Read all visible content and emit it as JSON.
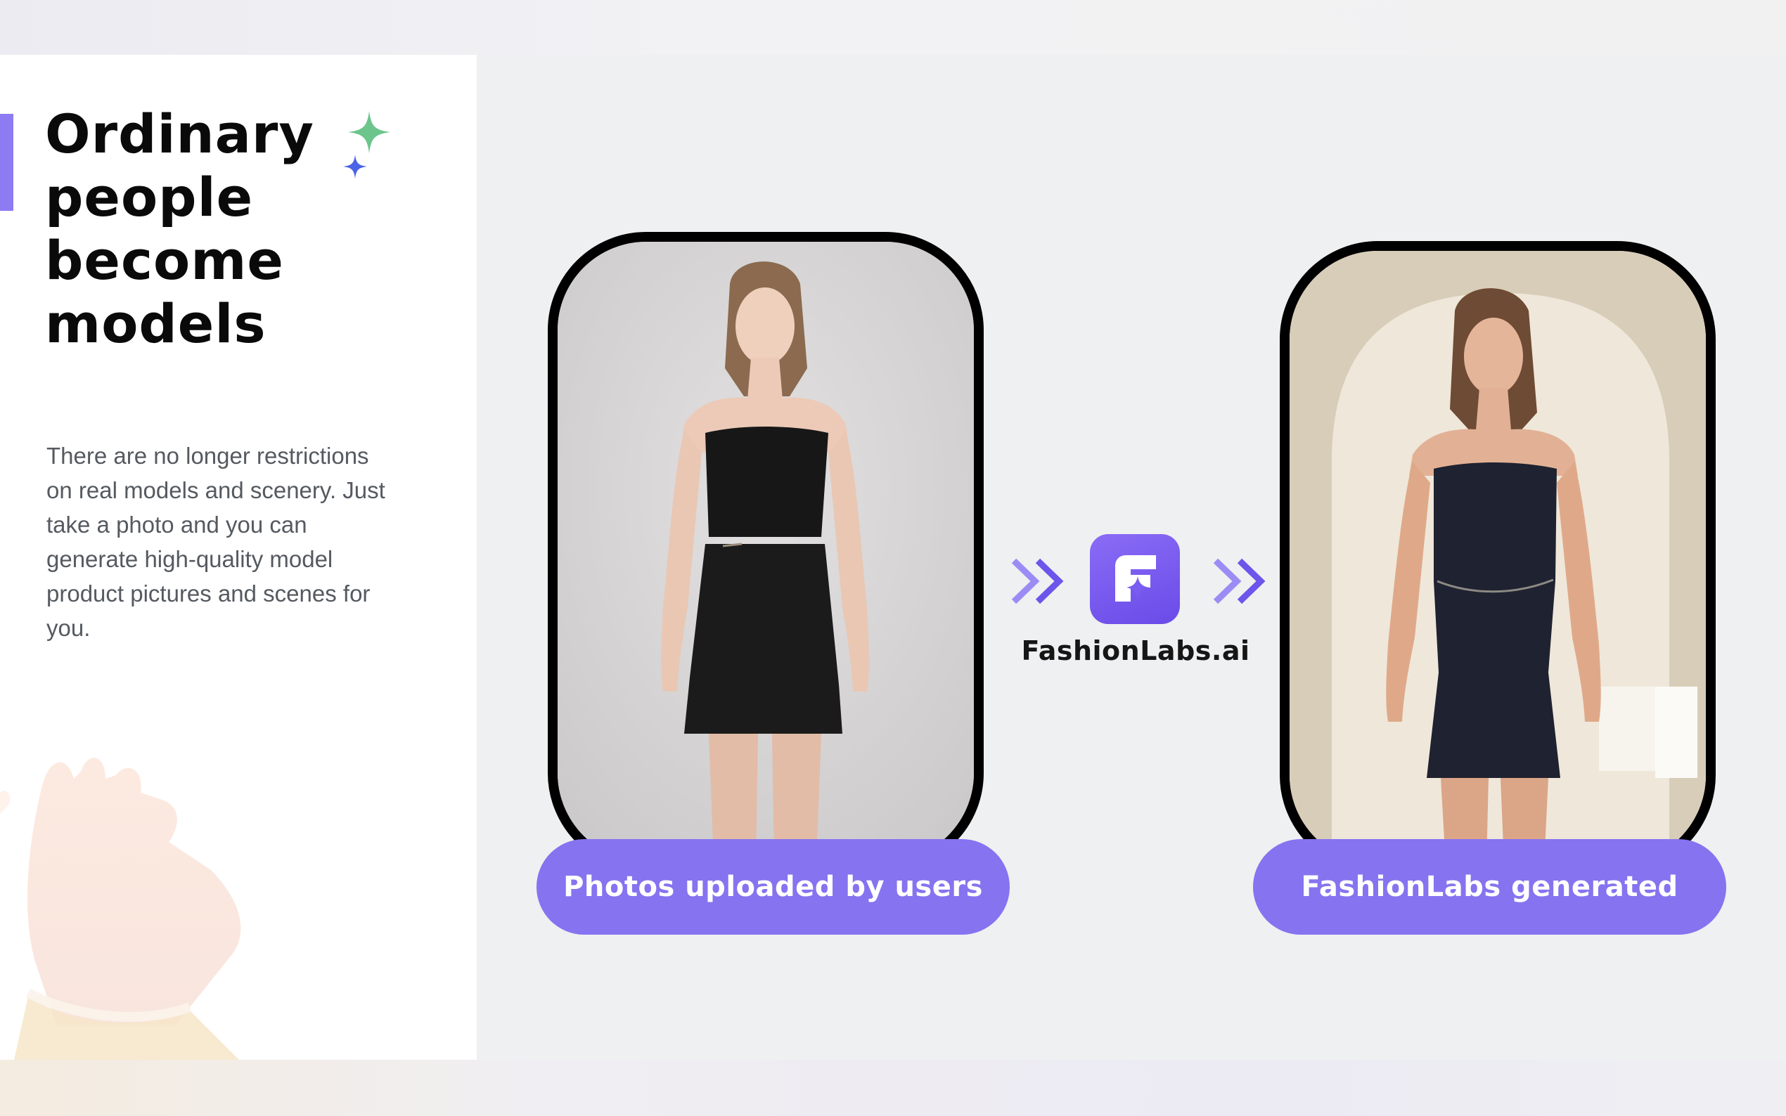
{
  "headline": "Ordinary people become models",
  "description": "There are no longer restrictions on real models and scenery. Just take a photo and you can generate high-quality model product pictures and scenes for you.",
  "before_panel": {
    "label": "Photos uploaded by users",
    "image_alt": "Woman in black strapless dress on grey studio background"
  },
  "after_panel": {
    "label": "FashionLabs generated",
    "image_alt": "Model in black strapless dress in beige arched room"
  },
  "brand": {
    "name": "FashionLabs.ai",
    "icon": "fashionlabs-logo-icon"
  },
  "icons": [
    "sparkle-green-icon",
    "sparkle-blue-icon",
    "double-chevron-right-icon",
    "hands-illustration"
  ],
  "colors": {
    "accent": "#8673f0",
    "accent_bar": "#8d7bf2",
    "sparkle_green": "#6cc58c",
    "sparkle_blue": "#4b63e6",
    "headline": "#0a0a0a",
    "body_text": "#555a60"
  }
}
